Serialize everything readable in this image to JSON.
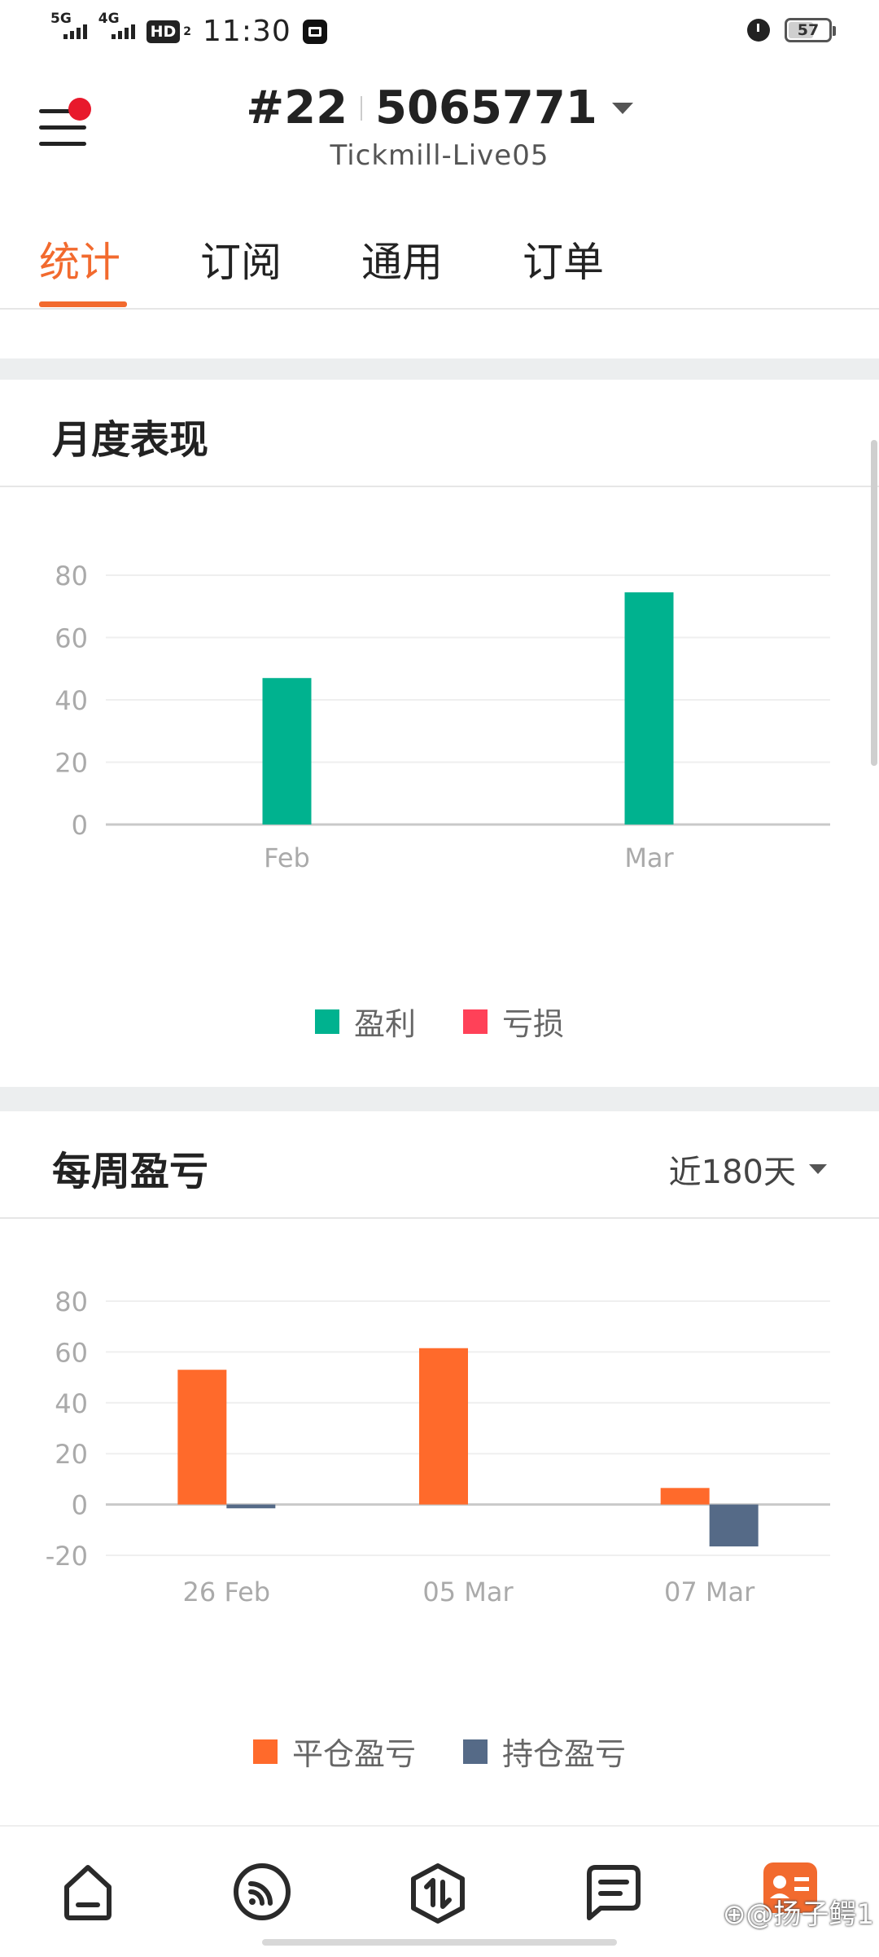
{
  "status_bar": {
    "net1": "5G",
    "net2": "4G",
    "hd": "HD",
    "hd_sub": "2",
    "time": "11:30",
    "battery": "57"
  },
  "header": {
    "account_prefix": "#22",
    "account_number": "5065771",
    "server": "Tickmill-Live05"
  },
  "tabs": [
    {
      "label": "统计",
      "active": true
    },
    {
      "label": "订阅",
      "active": false
    },
    {
      "label": "通用",
      "active": false
    },
    {
      "label": "订单",
      "active": false
    }
  ],
  "monthly_card": {
    "title": "月度表现",
    "legend": [
      {
        "label": "盈利",
        "color": "#00b28f"
      },
      {
        "label": "亏损",
        "color": "#ff4158"
      }
    ]
  },
  "weekly_card": {
    "title": "每周盈亏",
    "range_label": "近180天",
    "legend": [
      {
        "label": "平仓盈亏",
        "color": "#ff6a2b"
      },
      {
        "label": "持仓盈亏",
        "color": "#556a87"
      }
    ]
  },
  "chart_data": [
    {
      "type": "bar",
      "title": "月度表现",
      "categories": [
        "Feb",
        "Mar"
      ],
      "series": [
        {
          "name": "盈利",
          "color": "#00b28f",
          "values": [
            47,
            74.5
          ]
        },
        {
          "name": "亏损",
          "color": "#ff4158",
          "values": [
            0,
            0
          ]
        }
      ],
      "yticks": [
        0,
        20,
        40,
        60,
        80
      ],
      "ylim": [
        0,
        80
      ],
      "grid": true
    },
    {
      "type": "bar",
      "title": "每周盈亏",
      "categories": [
        "26 Feb",
        "05 Mar",
        "07 Mar"
      ],
      "series": [
        {
          "name": "平仓盈亏",
          "color": "#ff6a2b",
          "values": [
            53,
            61.5,
            6.5
          ]
        },
        {
          "name": "持仓盈亏",
          "color": "#556a87",
          "values": [
            -1.5,
            0,
            -16.5
          ]
        }
      ],
      "yticks": [
        -20,
        0,
        20,
        40,
        60,
        80
      ],
      "ylim": [
        -20,
        80
      ],
      "grid": true
    }
  ],
  "bottom_nav": [
    {
      "icon": "home-icon"
    },
    {
      "icon": "signal-icon"
    },
    {
      "icon": "trade-icon"
    },
    {
      "icon": "message-icon"
    },
    {
      "icon": "profile-icon"
    }
  ],
  "watermark": "⊕@扬子鳄1"
}
